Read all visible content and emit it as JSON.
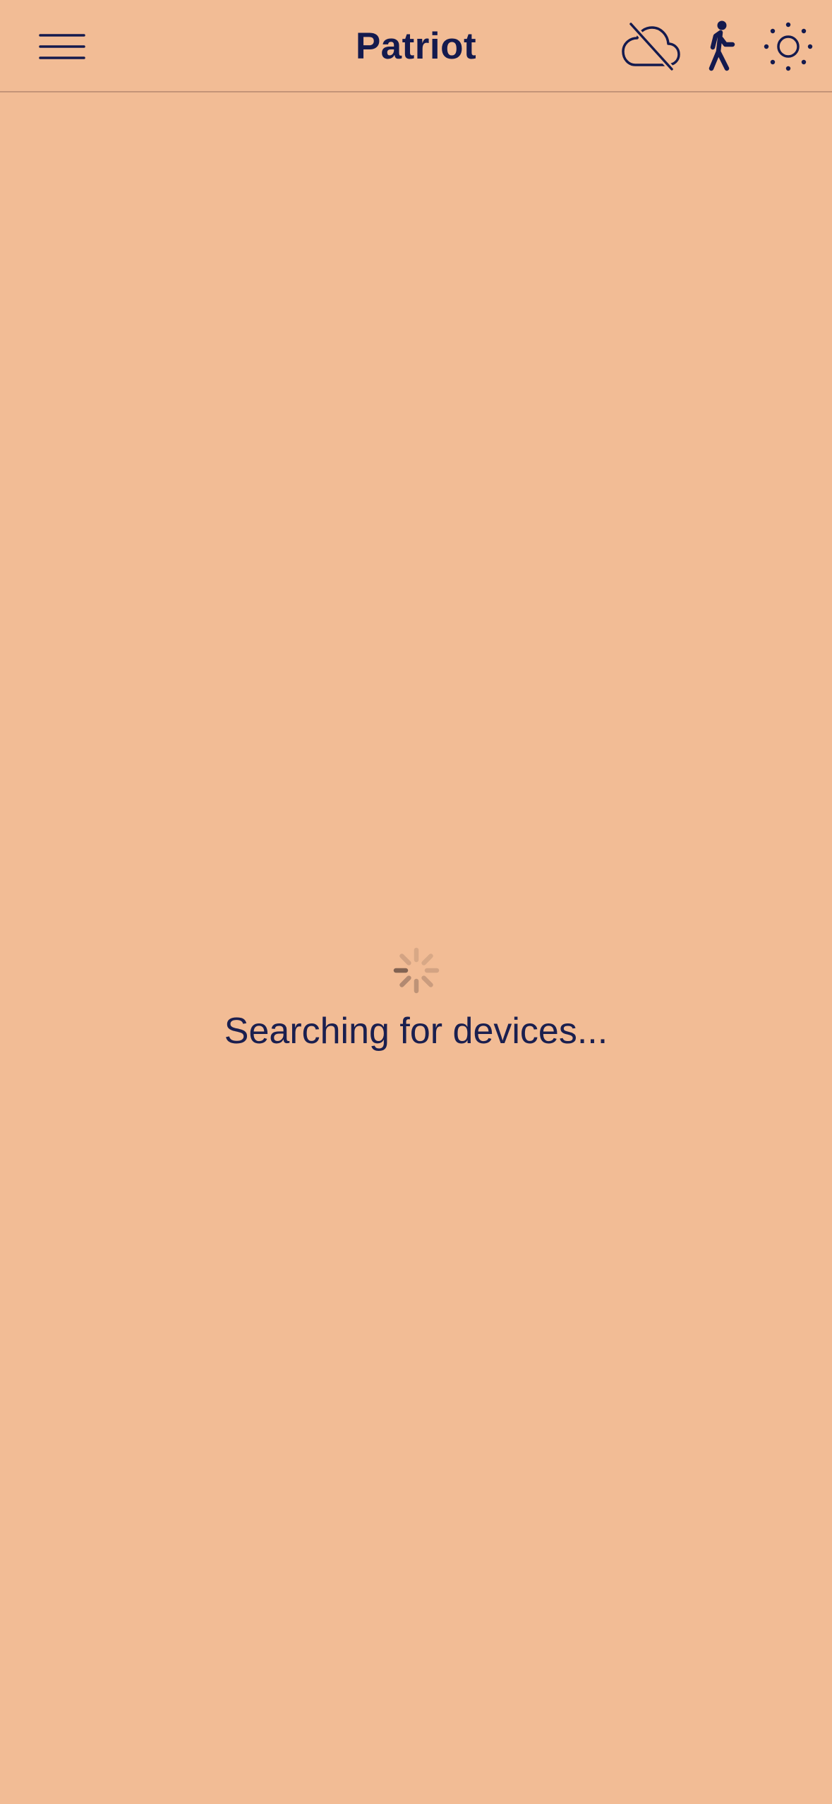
{
  "app": {
    "title": "Patriot"
  },
  "header": {
    "menu_icon": "hamburger-menu-icon",
    "cloud_icon": "cloud-off-icon",
    "activity_icon": "walking-person-icon",
    "theme_icon": "sun-brightness-icon"
  },
  "main": {
    "status_text": "Searching for devices...",
    "loading_icon": "activity-spinner-icon"
  },
  "colors": {
    "background": "#F2BC95",
    "foreground": "#141A4E",
    "divider": "#C49478",
    "spinner": "#8A6A5A"
  }
}
